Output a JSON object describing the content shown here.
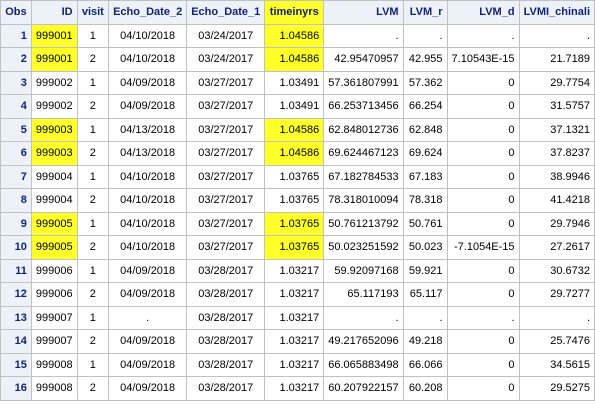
{
  "highlight_color": "#ffff2a",
  "header_bg": "#edf2f9",
  "header_text_color": "#112277",
  "columns": [
    "Obs",
    "ID",
    "visit",
    "Echo_Date_2",
    "Echo_Date_1",
    "timeinyrs",
    "LVM",
    "LVM_r",
    "LVM_d",
    "LVMI_chinali"
  ],
  "rows": [
    {
      "obs": "1",
      "id": "999001",
      "visit": "1",
      "d2": "04/10/2018",
      "d1": "03/24/2017",
      "time": "1.04586",
      "lvm": ".",
      "lvmr": ".",
      "lvmd": ".",
      "lvmi": "."
    },
    {
      "obs": "2",
      "id": "999001",
      "visit": "2",
      "d2": "04/10/2018",
      "d1": "03/24/2017",
      "time": "1.04586",
      "lvm": "42.95470957",
      "lvmr": "42.955",
      "lvmd": "7.10543E-15",
      "lvmi": "21.7189"
    },
    {
      "obs": "3",
      "id": "999002",
      "visit": "1",
      "d2": "04/09/2018",
      "d1": "03/27/2017",
      "time": "1.03491",
      "lvm": "57.361807991",
      "lvmr": "57.362",
      "lvmd": "0",
      "lvmi": "29.7754"
    },
    {
      "obs": "4",
      "id": "999002",
      "visit": "2",
      "d2": "04/09/2018",
      "d1": "03/27/2017",
      "time": "1.03491",
      "lvm": "66.253713456",
      "lvmr": "66.254",
      "lvmd": "0",
      "lvmi": "31.5757"
    },
    {
      "obs": "5",
      "id": "999003",
      "visit": "1",
      "d2": "04/13/2018",
      "d1": "03/27/2017",
      "time": "1.04586",
      "lvm": "62.848012736",
      "lvmr": "62.848",
      "lvmd": "0",
      "lvmi": "37.1321"
    },
    {
      "obs": "6",
      "id": "999003",
      "visit": "2",
      "d2": "04/13/2018",
      "d1": "03/27/2017",
      "time": "1.04586",
      "lvm": "69.624467123",
      "lvmr": "69.624",
      "lvmd": "0",
      "lvmi": "37.8237"
    },
    {
      "obs": "7",
      "id": "999004",
      "visit": "1",
      "d2": "04/10/2018",
      "d1": "03/27/2017",
      "time": "1.03765",
      "lvm": "67.182784533",
      "lvmr": "67.183",
      "lvmd": "0",
      "lvmi": "38.9946"
    },
    {
      "obs": "8",
      "id": "999004",
      "visit": "2",
      "d2": "04/10/2018",
      "d1": "03/27/2017",
      "time": "1.03765",
      "lvm": "78.318010094",
      "lvmr": "78.318",
      "lvmd": "0",
      "lvmi": "41.4218"
    },
    {
      "obs": "9",
      "id": "999005",
      "visit": "1",
      "d2": "04/10/2018",
      "d1": "03/27/2017",
      "time": "1.03765",
      "lvm": "50.761213792",
      "lvmr": "50.761",
      "lvmd": "0",
      "lvmi": "29.7946"
    },
    {
      "obs": "10",
      "id": "999005",
      "visit": "2",
      "d2": "04/10/2018",
      "d1": "03/27/2017",
      "time": "1.03765",
      "lvm": "50.023251592",
      "lvmr": "50.023",
      "lvmd": "-7.1054E-15",
      "lvmi": "27.2617"
    },
    {
      "obs": "11",
      "id": "999006",
      "visit": "1",
      "d2": "04/09/2018",
      "d1": "03/28/2017",
      "time": "1.03217",
      "lvm": "59.92097168",
      "lvmr": "59.921",
      "lvmd": "0",
      "lvmi": "30.6732"
    },
    {
      "obs": "12",
      "id": "999006",
      "visit": "2",
      "d2": "04/09/2018",
      "d1": "03/28/2017",
      "time": "1.03217",
      "lvm": "65.117193",
      "lvmr": "65.117",
      "lvmd": "0",
      "lvmi": "29.7277"
    },
    {
      "obs": "13",
      "id": "999007",
      "visit": "1",
      "d2": ".",
      "d1": "03/28/2017",
      "time": "1.03217",
      "lvm": ".",
      "lvmr": ".",
      "lvmd": ".",
      "lvmi": "."
    },
    {
      "obs": "14",
      "id": "999007",
      "visit": "2",
      "d2": "04/09/2018",
      "d1": "03/28/2017",
      "time": "1.03217",
      "lvm": "49.217652096",
      "lvmr": "49.218",
      "lvmd": "0",
      "lvmi": "25.7476"
    },
    {
      "obs": "15",
      "id": "999008",
      "visit": "1",
      "d2": "04/09/2018",
      "d1": "03/28/2017",
      "time": "1.03217",
      "lvm": "66.065883498",
      "lvmr": "66.066",
      "lvmd": "0",
      "lvmi": "34.5615"
    },
    {
      "obs": "16",
      "id": "999008",
      "visit": "2",
      "d2": "04/09/2018",
      "d1": "03/28/2017",
      "time": "1.03217",
      "lvm": "60.207922157",
      "lvmr": "60.208",
      "lvmd": "0",
      "lvmi": "29.5275"
    }
  ],
  "highlighted": {
    "id_rows": [
      0,
      1,
      4,
      5,
      8,
      9
    ],
    "time_rows": [
      0,
      1,
      4,
      5,
      8,
      9
    ]
  }
}
